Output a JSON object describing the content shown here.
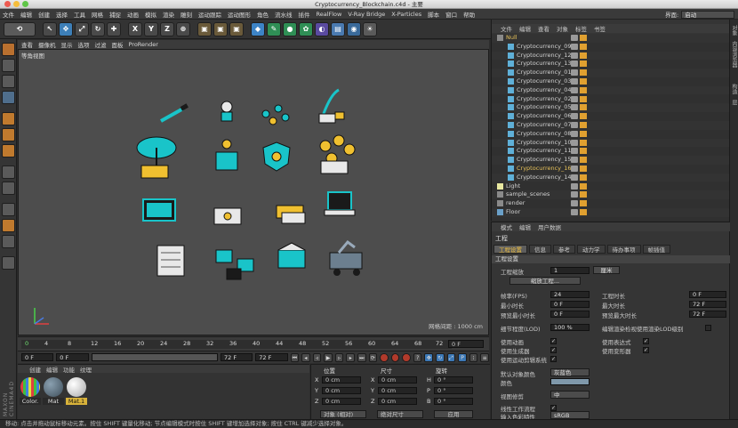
{
  "window": {
    "title": "Cryptocurrency_Blockchain.c4d - 主要"
  },
  "menubar": {
    "items": [
      "文件",
      "编辑",
      "创建",
      "选择",
      "工具",
      "网格",
      "捕捉",
      "动画",
      "模拟",
      "渲染",
      "雕刻",
      "运动跟踪",
      "运动图形",
      "角色",
      "流水线",
      "插件",
      "RealFlow",
      "V-Ray Bridge",
      "X-Particles",
      "脚本",
      "窗口",
      "帮助"
    ],
    "layout_label": "界面:",
    "layout_value": "启动"
  },
  "toolbar": {
    "axis_buttons": [
      "X",
      "Y",
      "Z"
    ]
  },
  "viewport": {
    "menu": [
      "查看",
      "摄像机",
      "显示",
      "选项",
      "过滤",
      "面板",
      "ProRender"
    ],
    "view_name": "等角视图",
    "grid_spacing": "网格间距 : 1000 cm"
  },
  "timeline": {
    "ticks": [
      "0",
      "4",
      "8",
      "12",
      "16",
      "20",
      "24",
      "28",
      "32",
      "36",
      "40",
      "44",
      "48",
      "52",
      "56",
      "60",
      "64",
      "68",
      "72"
    ],
    "current_frame": "0 F"
  },
  "transport": {
    "start": "0 F",
    "start2": "0 F",
    "end": "72 F",
    "end2": "72 F"
  },
  "materials": {
    "menu": [
      "创建",
      "编辑",
      "功能",
      "纹理"
    ],
    "items": [
      {
        "name": "Color."
      },
      {
        "name": "Mat"
      },
      {
        "name": "Mat.1"
      }
    ]
  },
  "coordinates": {
    "headers": {
      "position": "位置",
      "size": "尺寸",
      "rotation": "旋转"
    },
    "rows": [
      {
        "axis": "X",
        "pos": "0 cm",
        "size": "0 cm",
        "rot_axis": "H",
        "rot": "0 °"
      },
      {
        "axis": "Y",
        "pos": "0 cm",
        "size": "0 cm",
        "rot_axis": "P",
        "rot": "0 °"
      },
      {
        "axis": "Z",
        "pos": "0 cm",
        "size": "0 cm",
        "rot_axis": "B",
        "rot": "0 °"
      }
    ],
    "mode": "对象 (相对)",
    "size_mode": "绝对尺寸",
    "apply": "应用"
  },
  "objects": {
    "menu": [
      "文件",
      "编辑",
      "查看",
      "对象",
      "标签",
      "书签"
    ],
    "rows": [
      {
        "name": "Null",
        "icon": "null",
        "highlight": true
      },
      {
        "name": "Cryptocurrency_09",
        "icon": "object",
        "highlight": false
      },
      {
        "name": "Cryptocurrency_12",
        "icon": "object",
        "highlight": false
      },
      {
        "name": "Cryptocurrency_13",
        "icon": "object",
        "highlight": false
      },
      {
        "name": "Cryptocurrency_01",
        "icon": "object",
        "highlight": false
      },
      {
        "name": "Cryptocurrency_03",
        "icon": "object",
        "highlight": false
      },
      {
        "name": "Cryptocurrency_04",
        "icon": "object",
        "highlight": false
      },
      {
        "name": "Cryptocurrency_02",
        "icon": "object",
        "highlight": false
      },
      {
        "name": "Cryptocurrency_05",
        "icon": "object",
        "highlight": false
      },
      {
        "name": "Cryptocurrency_06",
        "icon": "object",
        "highlight": false
      },
      {
        "name": "Cryptocurrency_07",
        "icon": "object",
        "highlight": false
      },
      {
        "name": "Cryptocurrency_08",
        "icon": "object",
        "highlight": false
      },
      {
        "name": "Cryptocurrency_10",
        "icon": "object",
        "highlight": false
      },
      {
        "name": "Cryptocurrency_11",
        "icon": "object",
        "highlight": false
      },
      {
        "name": "Cryptocurrency_15",
        "icon": "object",
        "highlight": false
      },
      {
        "name": "Cryptocurrency_16",
        "icon": "object",
        "highlight": true
      },
      {
        "name": "Cryptocurrency_14",
        "icon": "object",
        "highlight": false
      },
      {
        "name": "Light",
        "icon": "light",
        "highlight": false
      },
      {
        "name": "sample_scenes",
        "icon": "null",
        "highlight": false
      },
      {
        "name": "render",
        "icon": "null",
        "highlight": false
      },
      {
        "name": "Floor",
        "icon": "floor",
        "highlight": false
      }
    ]
  },
  "side_tabs": [
    "对象",
    "内容浏览器",
    "构造",
    "层"
  ],
  "attributes": {
    "menu": [
      "模式",
      "编辑",
      "用户数据"
    ],
    "title": "工程",
    "tabs": [
      "工程设置",
      "信息",
      "参考",
      "动力学",
      "待办事项",
      "帧插值"
    ],
    "section": "工程设置",
    "scale_label": "工程缩放",
    "scale_value": "1",
    "scale_unit": "厘米",
    "scale_button": "缩放工程...",
    "fps_label": "帧率(FPS)",
    "fps": "24",
    "duration_label": "工程时长",
    "duration": "0 F",
    "min_label": "最小时长",
    "min": "0 F",
    "max_label": "最大时长",
    "max": "72 F",
    "pmin_label": "预览最小时长",
    "pmin": "0 F",
    "pmax_label": "预览最大时长",
    "pmax": "72 F",
    "lod_label": "细节程度(LOD)",
    "lod": "100 %",
    "lod_render": "编辑渲染检视使用渲染LOD级别",
    "checks": [
      "使用动画",
      "使用表达式",
      "使用生成器",
      "使用变形器",
      "使用运动剪辑系统"
    ],
    "default_color_label": "默认对象颜色",
    "default_color": "灰蓝色",
    "color_label": "颜色",
    "view_clip_label": "视图修剪",
    "view_clip": "中",
    "linear_label": "线性工作流程",
    "input_color_label": "输入色彩特性",
    "input_color": "sRGB"
  },
  "status": "移动: 点击并拖动鼠标移动元素。按住 SHIFT 键量化移动; 节点编辑模式时按住 SHIFT 键增加选择对象; 按住 CTRL 键减少选择对象。"
}
